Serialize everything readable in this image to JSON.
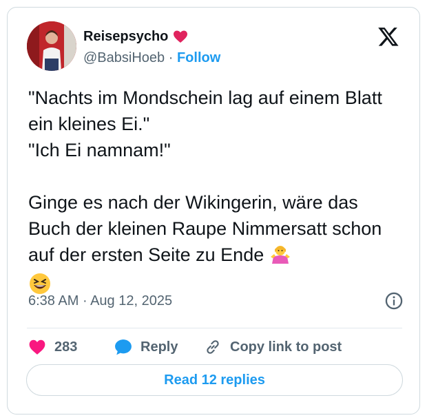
{
  "author": {
    "display_name": "Reisepsycho",
    "badge_icon": "red-heart-icon",
    "handle": "@BabsiHoeb",
    "separator": "·",
    "follow_label": "Follow"
  },
  "brand": {
    "logo_icon": "x-logo-icon"
  },
  "tweet": {
    "line1": "\"Nachts im Mondschein lag auf einem Blatt ein kleines Ei.\"",
    "line2": "\"Ich Ei namnam!\"",
    "line3": "Ginge es nach der Wikingerin, wäre das Buch der kleinen Raupe Nimmersatt schon auf der ersten Seite zu Ende",
    "emoji_1": "person-shrugging-emoji",
    "emoji_2": "grinning-squinting-face-emoji"
  },
  "meta": {
    "time": "6:38 AM",
    "separator": "·",
    "date": "Aug 12, 2025",
    "info_icon": "info-icon"
  },
  "actions": {
    "like_count": "283",
    "reply_label": "Reply",
    "copy_link_label": "Copy link to post"
  },
  "footer": {
    "read_replies_label": "Read 12 replies"
  },
  "colors": {
    "accent": "#1d9bf0",
    "text": "#0f1419",
    "muted": "#536471",
    "like": "#f91880",
    "border": "#cfd9de"
  }
}
